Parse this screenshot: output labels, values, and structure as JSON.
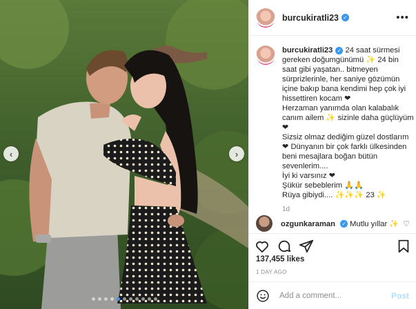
{
  "post": {
    "username": "burcukiratli23",
    "verified_icon": "verified-badge-icon",
    "more_icon": "more-options-icon",
    "caption_lines": [
      "24 saat sürmesi",
      "gereken doğumgünümü ✨ 24 bin",
      "saat gibi yaşatan.. bitmeyen",
      "sürprizlerinle, her saniye gözümün",
      "içine bakıp bana kendimi hep çok iyi",
      "hissettiren kocam ❤",
      "Herzaman yanımda olan kalabalık",
      "canım ailem ✨ sizinle daha güçlüyüm",
      "❤",
      "Sizsiz olmaz dediğim güzel dostlarım",
      "❤ Dünyanın bir çok farklı ülkesinden",
      "beni mesajlara boğan bütün",
      "sevenlerim....",
      "İyi ki varsınız ❤",
      "Şükür sebeblerim 🙏🙏",
      "Rüya gibiydi.... ✨✨✨ 23 ✨"
    ],
    "time_ago": "1d",
    "likes": "137,455 likes",
    "date": "1 DAY AGO"
  },
  "comments": [
    {
      "username": "ozgunkaraman",
      "verified": true,
      "text": "Mutlu yıllar ✨"
    }
  ],
  "add_comment": {
    "placeholder": "Add a comment...",
    "post_label": "Post"
  },
  "carousel": {
    "prev_label": "‹",
    "next_label": "›",
    "total": 11,
    "active_index": 4
  },
  "colors": {
    "accent": "#3897f0",
    "post_disabled": "#b2dffc",
    "muted": "#8e8e8e"
  }
}
